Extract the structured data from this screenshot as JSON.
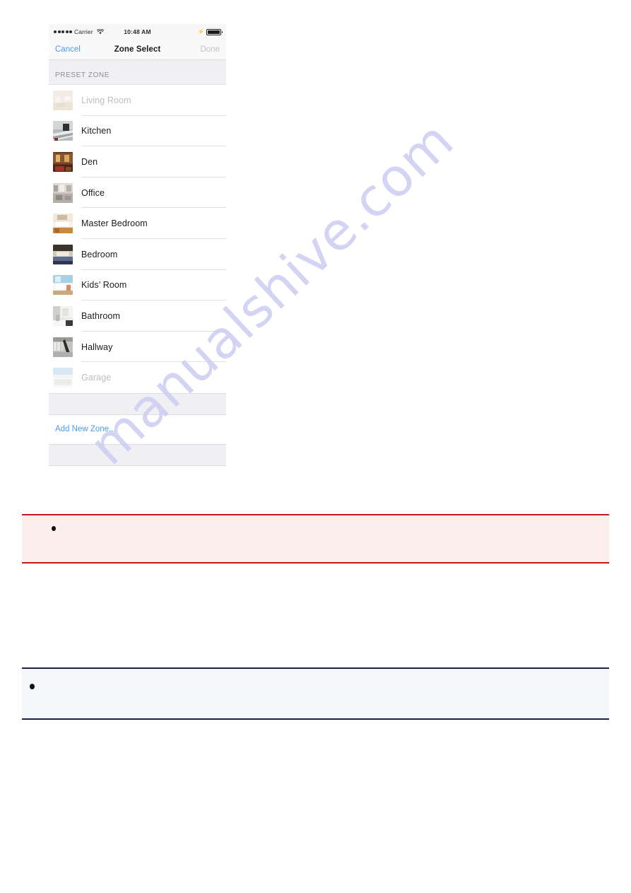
{
  "watermark": {
    "text": "manualshive.com",
    "color": "#ccccf2"
  },
  "phone": {
    "status_bar": {
      "signal_dots": 5,
      "carrier": "Carrier",
      "wifi_icon": "wifi-icon",
      "time": "10:48 AM",
      "charging_icon": "bolt-icon",
      "battery_icon": "battery-icon",
      "battery_level_percent": 100
    },
    "nav_bar": {
      "cancel_label": "Cancel",
      "title": "Zone Select",
      "done_label": "Done",
      "done_disabled": true,
      "cancel_color": "#4b9bf0",
      "done_color": "#c2c2c2"
    },
    "section_header": "PRESET ZONE",
    "zones": [
      {
        "label": "Living Room",
        "thumb": "living-room-thumb",
        "dimmed": true
      },
      {
        "label": "Kitchen",
        "thumb": "kitchen-thumb",
        "dimmed": false
      },
      {
        "label": "Den",
        "thumb": "den-thumb",
        "dimmed": false
      },
      {
        "label": "Office",
        "thumb": "office-thumb",
        "dimmed": false
      },
      {
        "label": "Master Bedroom",
        "thumb": "master-bedroom-thumb",
        "dimmed": false
      },
      {
        "label": "Bedroom",
        "thumb": "bedroom-thumb",
        "dimmed": false
      },
      {
        "label": "Kids’ Room",
        "thumb": "kids-room-thumb",
        "dimmed": false
      },
      {
        "label": "Bathroom",
        "thumb": "bathroom-thumb",
        "dimmed": false
      },
      {
        "label": "Hallway",
        "thumb": "hallway-thumb",
        "dimmed": false
      },
      {
        "label": "Garage",
        "thumb": "garage-thumb",
        "dimmed": true
      }
    ],
    "add_new_zone_label": "Add New Zone...",
    "add_new_zone_color": "#4b9bf0"
  },
  "notes": {
    "warning": {
      "text": "",
      "accent_color": "#c01a1a",
      "background": "#fdeeee"
    },
    "info": {
      "text": "",
      "accent_color": "#1b2340",
      "background": "#f4f6fa"
    }
  }
}
